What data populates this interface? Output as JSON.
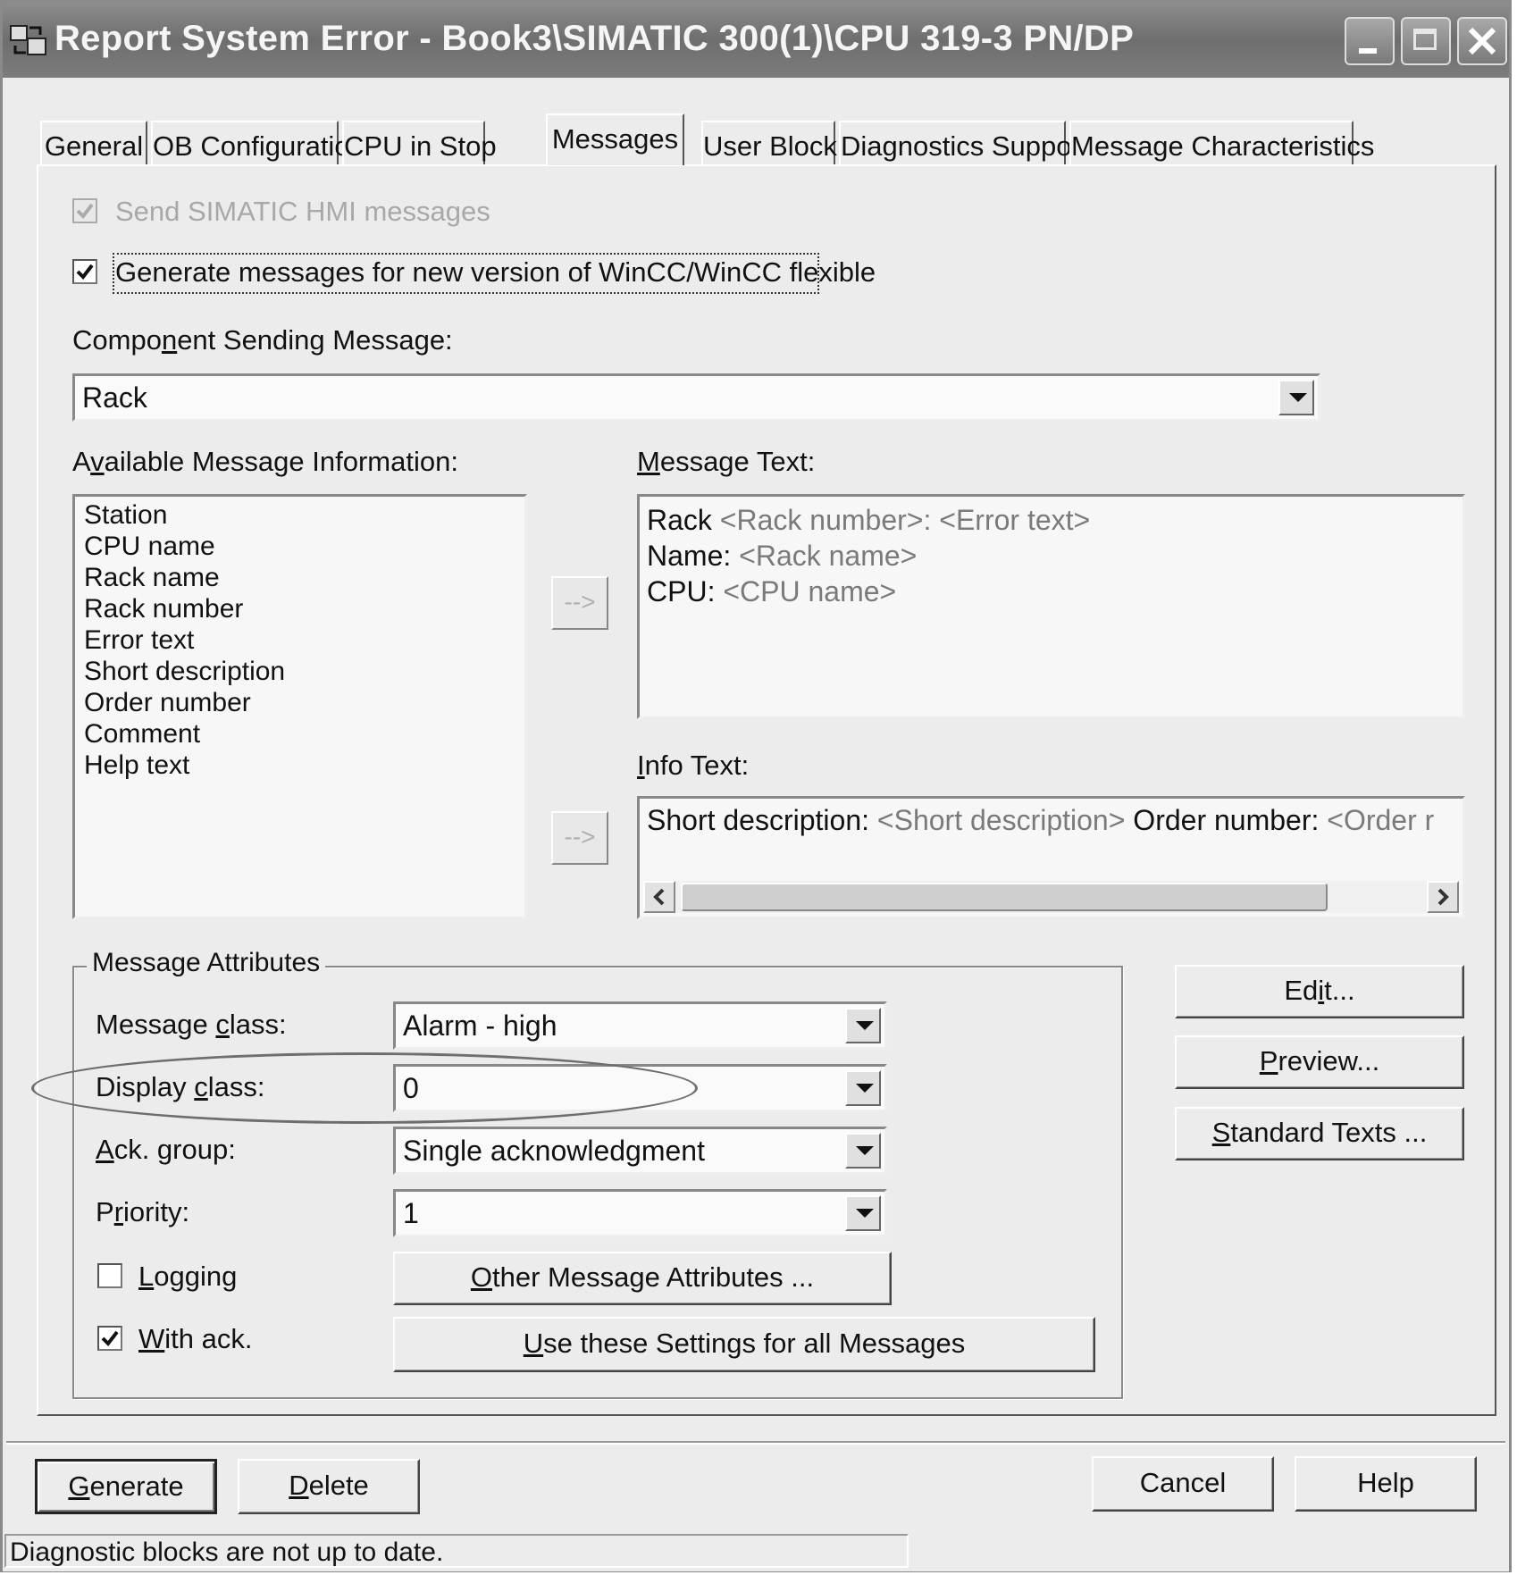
{
  "window": {
    "title": "Report System Error - Book3\\SIMATIC 300(1)\\CPU 319-3 PN/DP",
    "icons": {
      "app": "report-system-error-app-icon",
      "minimize": "minimize-icon",
      "maximize": "maximize-icon",
      "close": "close-icon"
    }
  },
  "tabs": [
    {
      "label": "General"
    },
    {
      "label": "OB Configuration"
    },
    {
      "label": "CPU in Stop"
    },
    {
      "label": "Messages",
      "active": true
    },
    {
      "label": "User Block"
    },
    {
      "label": "Diagnostics Support"
    },
    {
      "label": "Message Characteristics"
    }
  ],
  "messages": {
    "send_hmi": {
      "label": "Send SIMATIC HMI messages",
      "checked": true,
      "enabled": false
    },
    "generate_new_version": {
      "label": "Generate messages for new version of WinCC/WinCC flexible",
      "checked": true
    },
    "component_label": {
      "before": "Compo",
      "mnemonic": "n",
      "after": "ent Sending Message:"
    },
    "component_value": "Rack",
    "available_label": {
      "before": "A",
      "mnemonic": "v",
      "after": "ailable Message Information:"
    },
    "available_items": [
      "Station",
      "CPU name",
      "Rack name",
      "Rack number",
      "Error text",
      "Short description",
      "Order number",
      "Comment",
      "Help text"
    ],
    "add_arrow_label": "-->",
    "message_text_label": {
      "before": "",
      "mnemonic": "M",
      "after": "essage Text:"
    },
    "message_text_lines": [
      {
        "prefix": "Rack ",
        "field": "<Rack number>: <Error text>"
      },
      {
        "prefix": "Name: ",
        "field": "<Rack name>"
      },
      {
        "prefix": "CPU: ",
        "field": "<CPU name>"
      }
    ],
    "info_text_label": {
      "before": "",
      "mnemonic": "I",
      "after": "nfo Text:"
    },
    "info_text_line": {
      "p1": "Short description: ",
      "f1": "<Short description>",
      "p2": " Order number: ",
      "f2": "<Order r"
    },
    "attributes": {
      "title": "Message Attributes",
      "message_class": {
        "label_before": "Message ",
        "mnemonic": "c",
        "label_after": "lass:",
        "value": "Alarm - high"
      },
      "display_class": {
        "label_before": "Display ",
        "mnemonic": "c",
        "label_after": "lass:",
        "value": "0"
      },
      "ack_group": {
        "label_before": "",
        "mnemonic": "A",
        "label_after": "ck. group:",
        "value": "Single acknowledgment"
      },
      "priority": {
        "label_before": "P",
        "mnemonic": "r",
        "label_after": "iority:",
        "value": "1"
      },
      "logging": {
        "mnemonic": "L",
        "label_after": "ogging",
        "checked": false
      },
      "with_ack": {
        "mnemonic": "W",
        "label_after": "ith ack.",
        "checked": true
      },
      "other_attributes_button": {
        "mnemonic": "O",
        "label_after": "ther Message Attributes ..."
      },
      "use_settings_button": {
        "mnemonic": "U",
        "label_after": "se these Settings for all Messages"
      }
    },
    "side_buttons": {
      "edit": {
        "before": "Ed",
        "mnemonic": "i",
        "after": "t..."
      },
      "preview": {
        "before": "",
        "mnemonic": "P",
        "after": "review..."
      },
      "standard_texts": {
        "before": "",
        "mnemonic": "S",
        "after": "tandard Texts ..."
      }
    }
  },
  "footer": {
    "generate": {
      "mnemonic": "G",
      "after": "enerate"
    },
    "delete": {
      "mnemonic": "D",
      "after": "elete"
    },
    "cancel": "Cancel",
    "help": "Help"
  },
  "status": {
    "text": "Diagnostic blocks are not up to date."
  },
  "colors": {
    "titlebar": "#6e6e6e",
    "dialog_bg": "#ececec",
    "field_bg": "#f7f7f7",
    "annotation_ellipse": "#6e6e6e"
  }
}
